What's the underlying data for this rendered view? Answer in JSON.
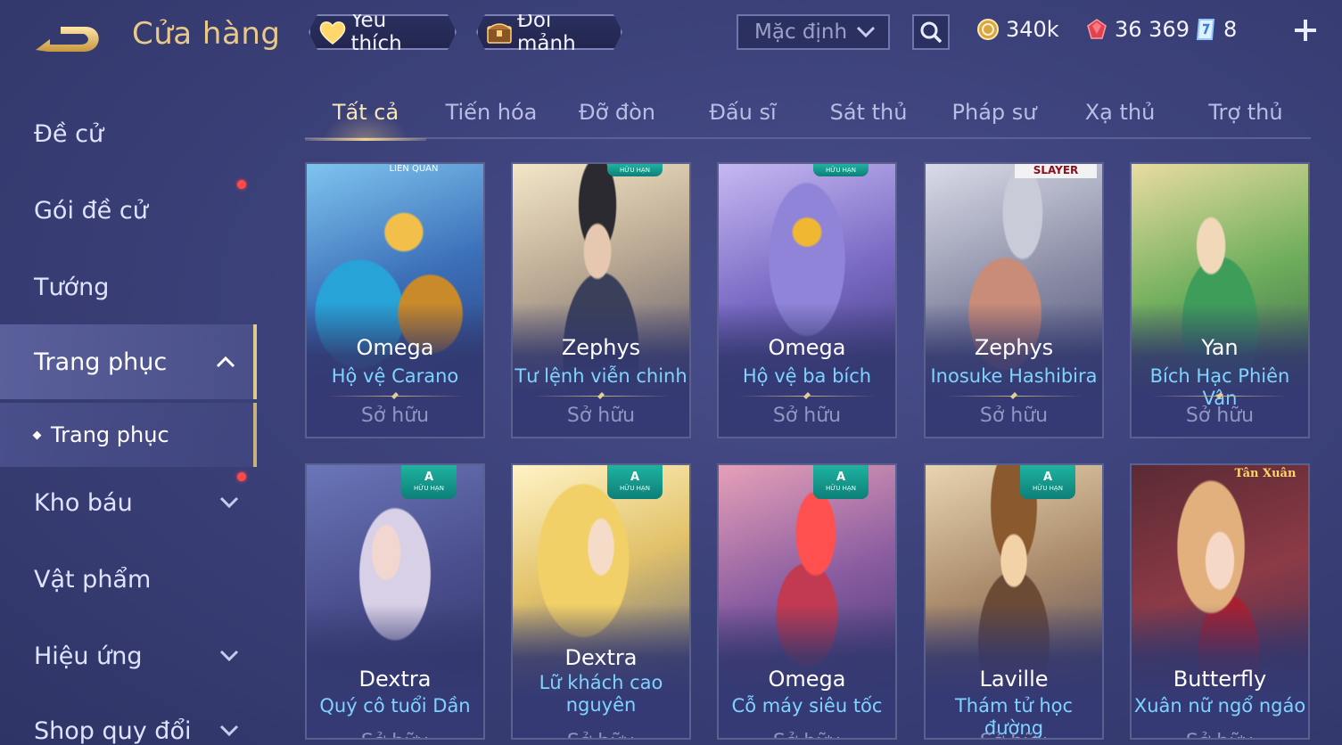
{
  "header": {
    "title": "Cửa hàng",
    "favorite_label": "Yêu thích",
    "exchange_label": "Đổi mảnh",
    "sort_value": "Mặc định",
    "currencies": {
      "gold": "340k",
      "gems": "36 369",
      "vouchers": "8"
    }
  },
  "sidebar": {
    "items": [
      {
        "label": "Đề cử"
      },
      {
        "label": "Gói đề cử"
      },
      {
        "label": "Tướng"
      },
      {
        "label": "Trang phục"
      },
      {
        "label": "Kho báu"
      },
      {
        "label": "Vật phẩm"
      },
      {
        "label": "Hiệu ứng"
      },
      {
        "label": "Shop quy đổi"
      }
    ],
    "sub_item": "Trang phục"
  },
  "tabs": [
    "Tất cả",
    "Tiến hóa",
    "Đỡ đòn",
    "Đấu sĩ",
    "Sát thủ",
    "Pháp sư",
    "Xạ thủ",
    "Trợ thủ"
  ],
  "cards": [
    {
      "hero": "Omega",
      "skin": "Hộ vệ Carano",
      "status": "Sở hữu"
    },
    {
      "hero": "Zephys",
      "skin": "Tư lệnh viễn chinh",
      "status": "Sở hữu"
    },
    {
      "hero": "Omega",
      "skin": "Hộ vệ ba bích",
      "status": "Sở hữu"
    },
    {
      "hero": "Zephys",
      "skin": "Inosuke Hashibira",
      "status": "Sở hữu"
    },
    {
      "hero": "Yan",
      "skin": "Bích Hạc Phiên Vân",
      "status": "Sở hữu"
    },
    {
      "hero": "Dextra",
      "skin": "Quý cô tuổi Dần",
      "status": "Sở hữu"
    },
    {
      "hero": "Dextra",
      "skin": "Lữ khách cao nguyên",
      "status": "Sở hữu"
    },
    {
      "hero": "Omega",
      "skin": "Cỗ máy siêu tốc",
      "status": "Sở hữu"
    },
    {
      "hero": "Laville",
      "skin": "Thám tử học đường",
      "status": "Sở hữu"
    },
    {
      "hero": "Butterfly",
      "skin": "Xuân nữ ngổ ngáo",
      "status": "Sở hữu"
    }
  ],
  "badge": {
    "rank": "A",
    "limited": "HỮU HẠN"
  },
  "card_overlays": {
    "card1_logo": "LIÊN QUÂN",
    "card4_logo": "SLAYER",
    "card10_logo": "Tân Xuân"
  },
  "colors": {
    "background": "#3c417a",
    "accent_gold": "#e9c98a",
    "skin_name": "#7fd3ff",
    "badge": "#1fb3a0",
    "notification": "#ff4a4a"
  }
}
